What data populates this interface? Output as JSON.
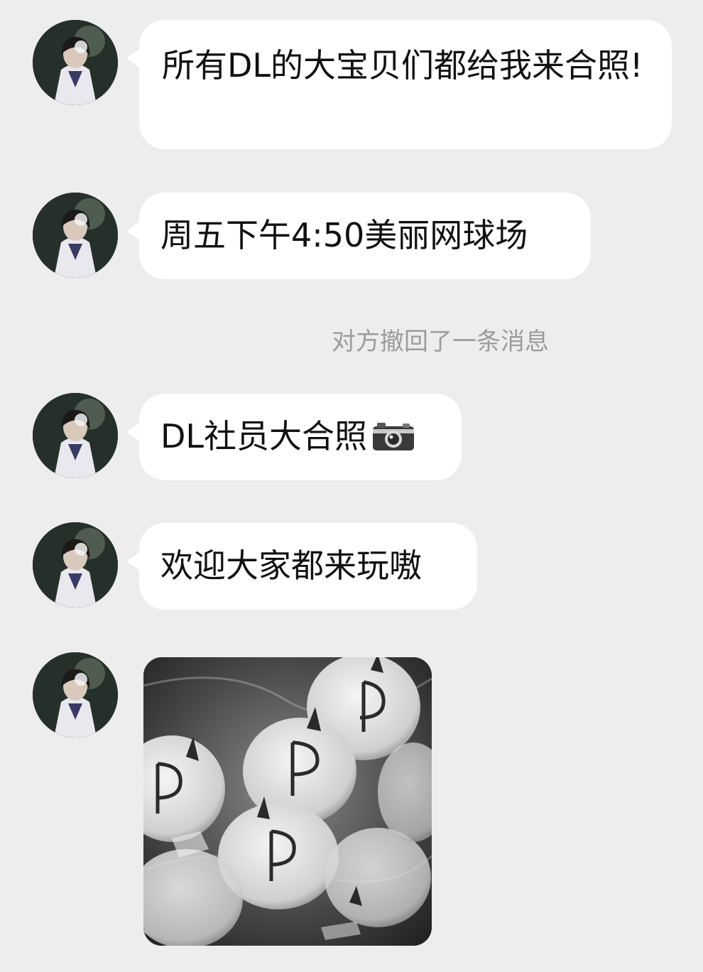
{
  "messages": [
    {
      "text": "所有DL的大宝贝们都给我来合照!"
    },
    {
      "text": "周五下午4:50美丽网球场"
    },
    {
      "text": "DL社员大合照"
    },
    {
      "text": "欢迎大家都来玩嗷"
    }
  ],
  "system_notice": "对方撤回了一条消息",
  "icons": {
    "camera": "camera-emoji-icon",
    "avatar": "user-avatar"
  },
  "colors": {
    "background": "#ededed",
    "bubble": "#ffffff",
    "notice_text": "#9c9c9c"
  }
}
